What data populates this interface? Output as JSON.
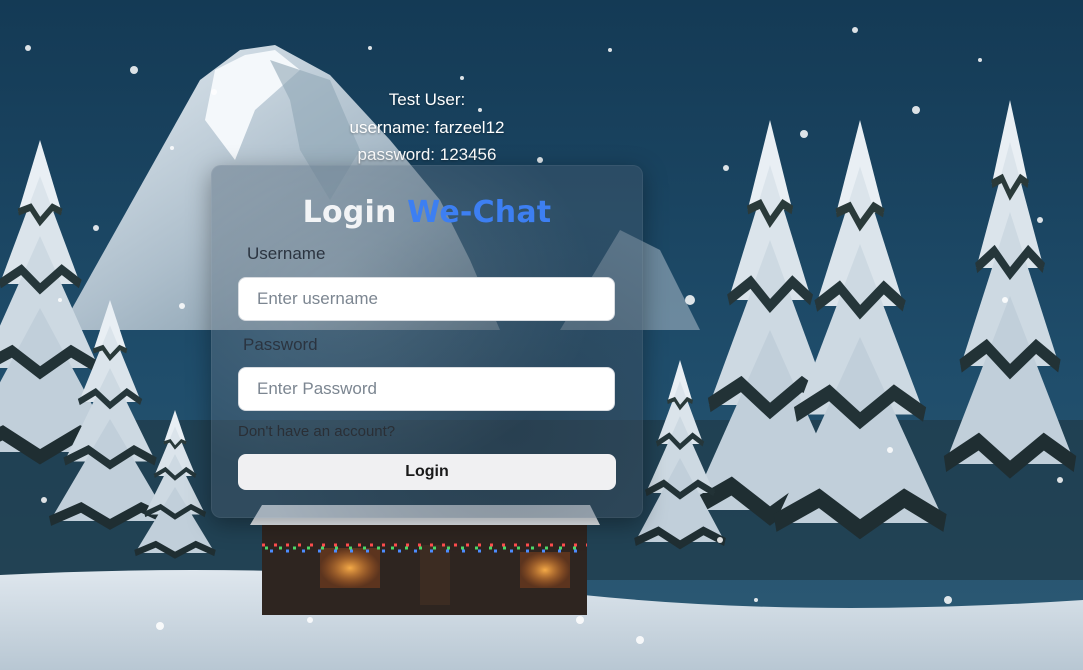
{
  "test_user": {
    "heading": "Test User:",
    "username_line": "username: farzeel12",
    "password_line": "password: 123456"
  },
  "login_card": {
    "title_prefix": "Login",
    "title_brand": "We-Chat",
    "brand_color": "#3d7ff2",
    "username_label": "Username",
    "username_placeholder": "Enter username",
    "username_value": "",
    "password_label": "Password",
    "password_placeholder": "Enter Password",
    "password_value": "",
    "signup_link": "Don't have an account?",
    "login_button": "Login"
  },
  "background": {
    "scene": "snowy-night-mountain-cabin",
    "sky_color": "#1a4560",
    "snow_color": "#e8eef3"
  }
}
